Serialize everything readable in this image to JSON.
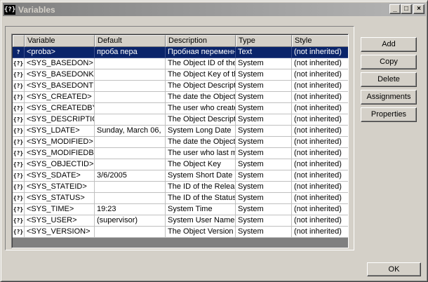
{
  "window": {
    "title": "Variables",
    "icon_label": "{?}",
    "controls": {
      "minimize": "_",
      "maximize": "□",
      "close": "×"
    }
  },
  "table": {
    "columns": [
      "",
      "Variable",
      "Default",
      "Description",
      "Type",
      "Style"
    ],
    "rows": [
      {
        "icon": "?",
        "variable": "<proba>",
        "default": "проба пера",
        "description": "Пробная переменная",
        "type": "Text",
        "style": "(not inherited)",
        "selected": true
      },
      {
        "icon": "{?}",
        "variable": "<SYS_BASEDON>",
        "default": "",
        "description": "The Object ID of the",
        "type": "System",
        "style": "(not inherited)"
      },
      {
        "icon": "{?}",
        "variable": "<SYS_BASEDONKEY>",
        "default": "",
        "description": "The Object Key of the",
        "type": "System",
        "style": "(not inherited)"
      },
      {
        "icon": "{?}",
        "variable": "<SYS_BASEDONTITLE>",
        "default": "",
        "description": "The Object Description",
        "type": "System",
        "style": "(not inherited)"
      },
      {
        "icon": "{?}",
        "variable": "<SYS_CREATED>",
        "default": "",
        "description": "The date the Object",
        "type": "System",
        "style": "(not inherited)"
      },
      {
        "icon": "{?}",
        "variable": "<SYS_CREATEDBY>",
        "default": "",
        "description": "The user who created",
        "type": "System",
        "style": "(not inherited)"
      },
      {
        "icon": "{?}",
        "variable": "<SYS_DESCRIPTION>",
        "default": "",
        "description": "The Object Description",
        "type": "System",
        "style": "(not inherited)"
      },
      {
        "icon": "{?}",
        "variable": "<SYS_LDATE>",
        "default": "Sunday, March 06,",
        "description": "System Long Date",
        "type": "System",
        "style": "(not inherited)"
      },
      {
        "icon": "{?}",
        "variable": "<SYS_MODIFIED>",
        "default": "",
        "description": "The date the Object",
        "type": "System",
        "style": "(not inherited)"
      },
      {
        "icon": "{?}",
        "variable": "<SYS_MODIFIEDBY>",
        "default": "",
        "description": "The user who last m",
        "type": "System",
        "style": "(not inherited)"
      },
      {
        "icon": "{?}",
        "variable": "<SYS_OBJECTID>",
        "default": "",
        "description": "The Object Key",
        "type": "System",
        "style": "(not inherited)"
      },
      {
        "icon": "{?}",
        "variable": "<SYS_SDATE>",
        "default": "3/6/2005",
        "description": "System Short Date",
        "type": "System",
        "style": "(not inherited)"
      },
      {
        "icon": "{?}",
        "variable": "<SYS_STATEID>",
        "default": "",
        "description": "The ID of the Release",
        "type": "System",
        "style": "(not inherited)"
      },
      {
        "icon": "{?}",
        "variable": "<SYS_STATUS>",
        "default": "",
        "description": "The ID of the Status",
        "type": "System",
        "style": "(not inherited)"
      },
      {
        "icon": "{?}",
        "variable": "<SYS_TIME>",
        "default": "19:23",
        "description": "System Time",
        "type": "System",
        "style": "(not inherited)"
      },
      {
        "icon": "{?}",
        "variable": "<SYS_USER>",
        "default": "(supervisor)",
        "description": "System User Name",
        "type": "System",
        "style": "(not inherited)"
      },
      {
        "icon": "{?}",
        "variable": "<SYS_VERSION>",
        "default": "",
        "description": "The Object Version",
        "type": "System",
        "style": "(not inherited)"
      }
    ]
  },
  "buttons": {
    "add": "Add",
    "copy": "Copy",
    "delete": "Delete",
    "assignments": "Assignments",
    "properties": "Properties",
    "ok": "OK"
  },
  "colors": {
    "selection": "#0a246a",
    "face": "#d4d0c8",
    "grid_bg": "#808080"
  }
}
